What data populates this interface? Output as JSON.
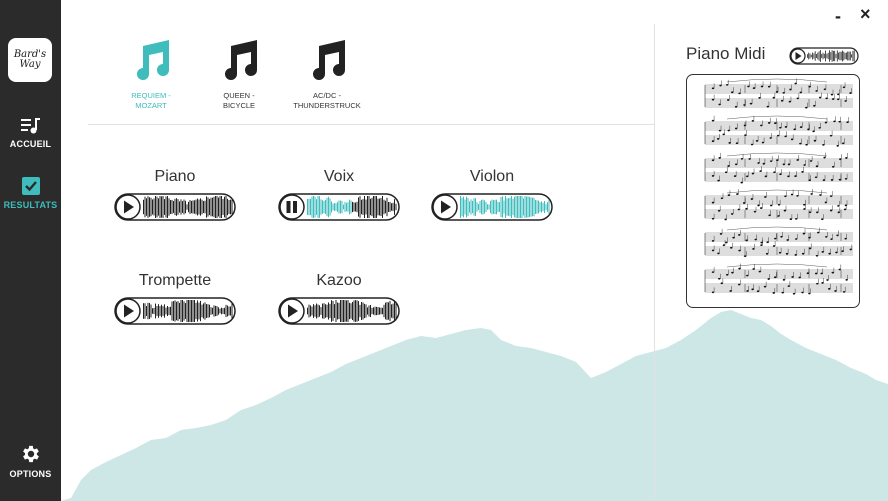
{
  "app": {
    "logo_text_line1": "Bard's",
    "logo_text_line2": "Way"
  },
  "sidebar": {
    "items": [
      {
        "label": "ACCUEIL",
        "icon": "music-list-icon"
      },
      {
        "label": "RESULTATS",
        "icon": "checkbox-icon",
        "active": true
      }
    ],
    "options_label": "OPTIONS"
  },
  "window": {
    "minimize": "-",
    "close": "×"
  },
  "songs": [
    {
      "line1": "REQUIEM -",
      "line2": "MOZART",
      "active": true
    },
    {
      "line1": "QUEEN -",
      "line2": "BICYCLE",
      "active": false
    },
    {
      "line1": "AC/DC -",
      "line2": "THUNDERSTRUCK",
      "active": false
    }
  ],
  "tracks": [
    {
      "name": "Piano",
      "state": "stopped",
      "progress": 0
    },
    {
      "name": "Voix",
      "state": "playing",
      "progress": 0.5
    },
    {
      "name": "Violon",
      "state": "stopped",
      "progress": 1.0
    },
    {
      "name": "Trompette",
      "state": "stopped",
      "progress": 0
    },
    {
      "name": "Kazoo",
      "state": "stopped",
      "progress": 0
    }
  ],
  "midi": {
    "title": "Piano Midi",
    "state": "stopped"
  },
  "colors": {
    "accent": "#3fbcbc",
    "sidebar": "#2b2b2b",
    "mountain": "#cde6e6"
  }
}
